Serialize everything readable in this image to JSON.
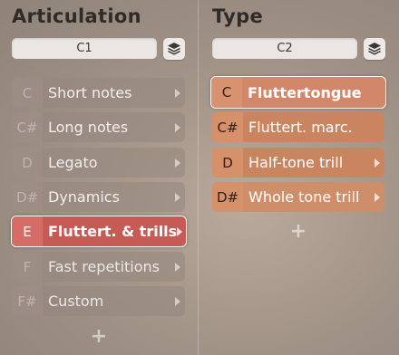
{
  "articulation": {
    "title": "Articulation",
    "key_field": "C1",
    "items": [
      {
        "key": "C",
        "label": "Short notes"
      },
      {
        "key": "C#",
        "label": "Long notes"
      },
      {
        "key": "D",
        "label": "Legato"
      },
      {
        "key": "D#",
        "label": "Dynamics"
      },
      {
        "key": "E",
        "label": "Fluttert. & trills"
      },
      {
        "key": "F",
        "label": "Fast repetitions"
      },
      {
        "key": "F#",
        "label": "Custom"
      }
    ],
    "selected_index": 4
  },
  "type": {
    "title": "Type",
    "key_field": "C2",
    "items": [
      {
        "key": "C",
        "label": "Fluttertongue"
      },
      {
        "key": "C#",
        "label": "Fluttert. marc."
      },
      {
        "key": "D",
        "label": "Half-tone trill"
      },
      {
        "key": "D#",
        "label": "Whole tone trill"
      }
    ],
    "selected_index": 0
  },
  "icons": {
    "layers": "layers-icon",
    "add": "plus-icon",
    "submenu": "chevron-right-icon"
  },
  "add_symbol": "+",
  "colors": {
    "articulation_active": "#c65b55",
    "type_item": "#c98560"
  }
}
